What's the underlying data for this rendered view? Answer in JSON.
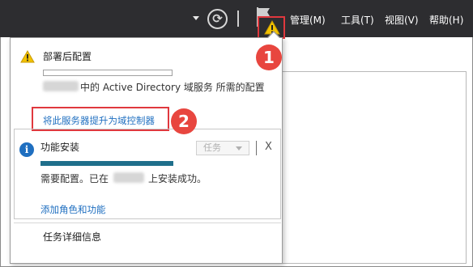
{
  "toolbar": {
    "menus": [
      {
        "label": "管理(M)"
      },
      {
        "label": "工具(T)"
      },
      {
        "label": "视图(V)"
      },
      {
        "label": "帮助(H)"
      }
    ],
    "refresh_glyph": "⟳"
  },
  "callouts": {
    "one": "1",
    "two": "2"
  },
  "notifications": {
    "post_deploy": {
      "title": "部署后配置",
      "description": "中的 Active Directory 域服务 所需的配置",
      "progress": 0,
      "link": "将此服务器提升为域控制器"
    },
    "feature_install": {
      "title": "功能安装",
      "task_button": "任务",
      "close_label": "X",
      "progress": 1.0,
      "status_prefix": "需要配置。已在",
      "status_suffix": "上安装成功。",
      "link": "添加角色和功能"
    },
    "task_details": "任务详细信息"
  },
  "colors": {
    "topbar": "#2d2d30",
    "highlight_red": "#e0383e",
    "badge_red": "#e8463f",
    "link_blue": "#1f6fc0",
    "progress_teal": "#1f6f8b",
    "warning_yellow": "#f2c200"
  },
  "icons": {
    "warning": "warning-icon",
    "info": "info-icon",
    "flag": "flag-icon",
    "refresh": "refresh-icon"
  }
}
